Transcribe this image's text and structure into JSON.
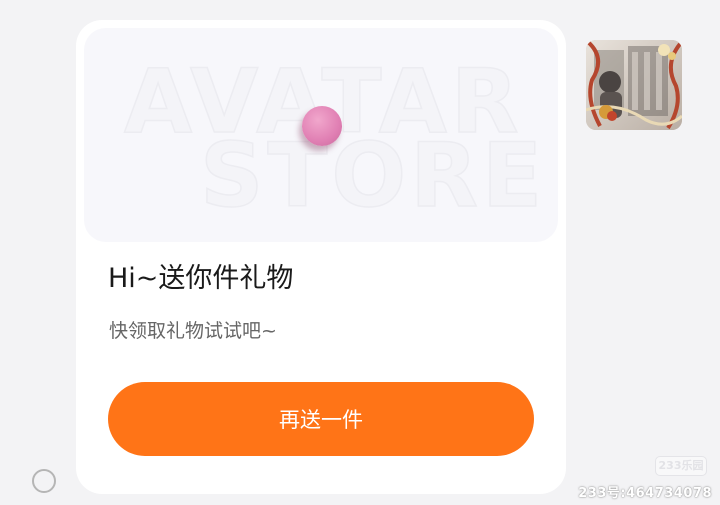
{
  "gift_card": {
    "banner_watermark_line1": "AVATAR",
    "banner_watermark_line2": "STORE",
    "title": "Hi~送你件礼物",
    "subtitle": "快领取礼物试试吧~",
    "button_label": "再送一件",
    "button_color": "#ff7417"
  },
  "sender_avatar": {
    "icon": "user-avatar"
  },
  "select_radio": {
    "icon": "radio-unchecked-icon",
    "checked": false
  },
  "watermark": {
    "badge": "233乐园",
    "id_text": "233号:464734078"
  }
}
